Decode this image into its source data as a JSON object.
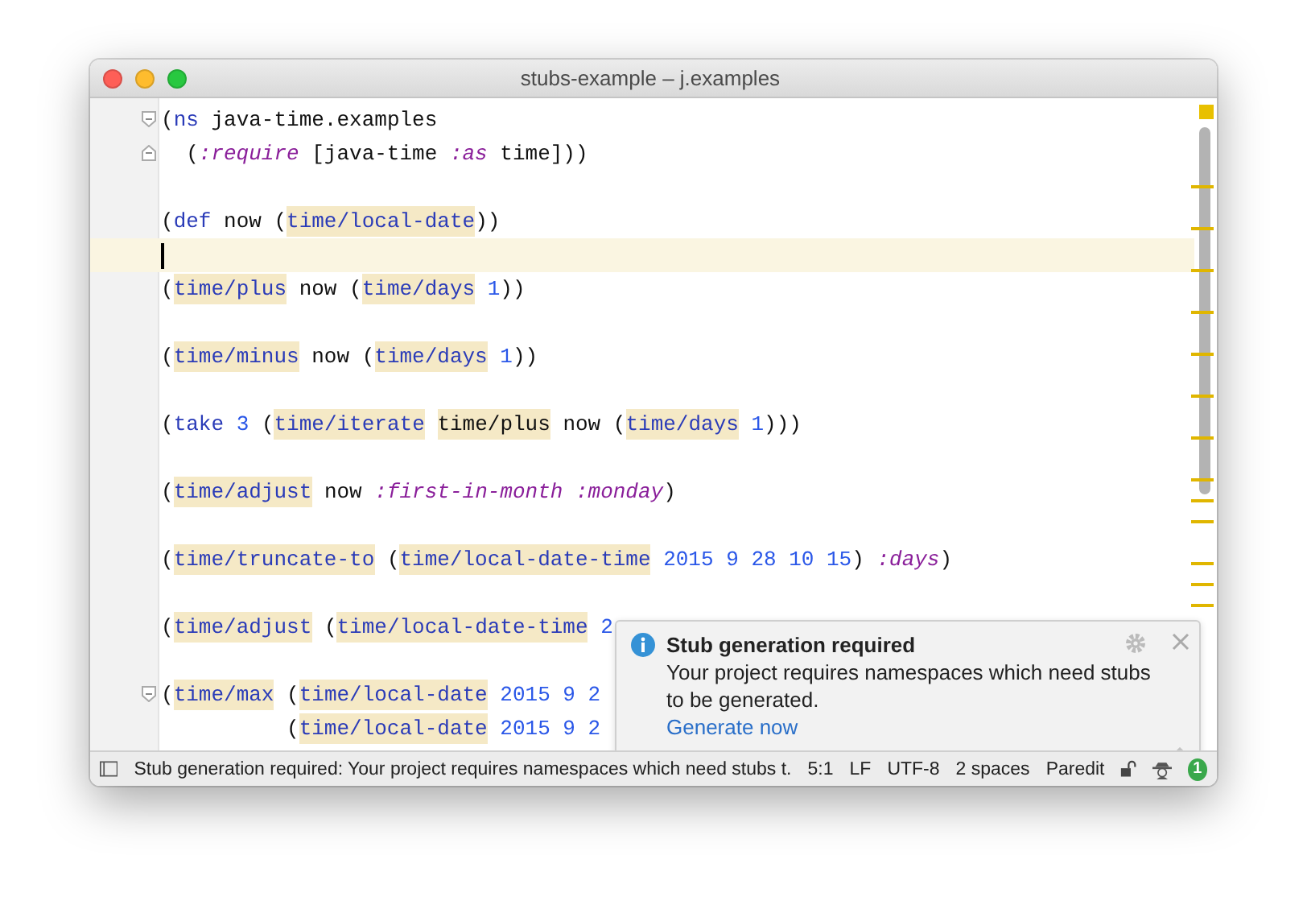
{
  "window": {
    "title": "stubs-example – j.examples"
  },
  "editor": {
    "lines": [
      {
        "kind": "code",
        "fold_start": true,
        "tokens": [
          {
            "kind": "plain",
            "text": "("
          },
          {
            "kind": "special",
            "text": "ns"
          },
          {
            "kind": "plain",
            "text": " java-time.examples"
          }
        ]
      },
      {
        "kind": "code",
        "fold_end": true,
        "tokens": [
          {
            "kind": "plain",
            "text": "  ("
          },
          {
            "kind": "keyword",
            "text": ":require"
          },
          {
            "kind": "plain",
            "text": " [java-time "
          },
          {
            "kind": "keyword",
            "text": ":as"
          },
          {
            "kind": "plain",
            "text": " time]))"
          }
        ]
      },
      {
        "kind": "blank"
      },
      {
        "kind": "code",
        "tokens": [
          {
            "kind": "plain",
            "text": "("
          },
          {
            "kind": "special",
            "text": "def"
          },
          {
            "kind": "plain",
            "text": " now ("
          },
          {
            "kind": "ref",
            "text": "time/local-date"
          },
          {
            "kind": "plain",
            "text": "))"
          }
        ]
      },
      {
        "kind": "cursor"
      },
      {
        "kind": "code",
        "tokens": [
          {
            "kind": "plain",
            "text": "("
          },
          {
            "kind": "ref",
            "text": "time/plus"
          },
          {
            "kind": "plain",
            "text": " now ("
          },
          {
            "kind": "ref",
            "text": "time/days"
          },
          {
            "kind": "number",
            "text": " 1"
          },
          {
            "kind": "plain",
            "text": "))"
          }
        ]
      },
      {
        "kind": "blank"
      },
      {
        "kind": "code",
        "tokens": [
          {
            "kind": "plain",
            "text": "("
          },
          {
            "kind": "ref",
            "text": "time/minus"
          },
          {
            "kind": "plain",
            "text": " now ("
          },
          {
            "kind": "ref",
            "text": "time/days"
          },
          {
            "kind": "number",
            "text": " 1"
          },
          {
            "kind": "plain",
            "text": "))"
          }
        ]
      },
      {
        "kind": "blank"
      },
      {
        "kind": "code",
        "tokens": [
          {
            "kind": "plain",
            "text": "("
          },
          {
            "kind": "special",
            "text": "take"
          },
          {
            "kind": "number",
            "text": " 3"
          },
          {
            "kind": "plain",
            "text": " ("
          },
          {
            "kind": "ref",
            "text": "time/iterate"
          },
          {
            "kind": "refplain",
            "text": " time/plus"
          },
          {
            "kind": "plain",
            "text": " now ("
          },
          {
            "kind": "ref",
            "text": "time/days"
          },
          {
            "kind": "number",
            "text": " 1"
          },
          {
            "kind": "plain",
            "text": ")))"
          }
        ]
      },
      {
        "kind": "blank"
      },
      {
        "kind": "code",
        "tokens": [
          {
            "kind": "plain",
            "text": "("
          },
          {
            "kind": "ref",
            "text": "time/adjust"
          },
          {
            "kind": "plain",
            "text": " now "
          },
          {
            "kind": "keyword",
            "text": ":first-in-month :monday"
          },
          {
            "kind": "plain",
            "text": ")"
          }
        ]
      },
      {
        "kind": "blank"
      },
      {
        "kind": "code",
        "tokens": [
          {
            "kind": "plain",
            "text": "("
          },
          {
            "kind": "ref",
            "text": "time/truncate-to"
          },
          {
            "kind": "plain",
            "text": " ("
          },
          {
            "kind": "ref",
            "text": "time/local-date-time"
          },
          {
            "kind": "number",
            "text": " 2015 9 28 10 15"
          },
          {
            "kind": "plain",
            "text": ") "
          },
          {
            "kind": "keyword",
            "text": ":days"
          },
          {
            "kind": "plain",
            "text": ")"
          }
        ]
      },
      {
        "kind": "blank"
      },
      {
        "kind": "code",
        "tokens": [
          {
            "kind": "plain",
            "text": "("
          },
          {
            "kind": "ref",
            "text": "time/adjust"
          },
          {
            "kind": "plain",
            "text": " ("
          },
          {
            "kind": "ref",
            "text": "time/local-date-time"
          },
          {
            "kind": "number",
            "text": " 2"
          }
        ]
      },
      {
        "kind": "blank"
      },
      {
        "kind": "code",
        "fold_start": true,
        "tokens": [
          {
            "kind": "plain",
            "text": "("
          },
          {
            "kind": "ref",
            "text": "time/max"
          },
          {
            "kind": "plain",
            "text": " ("
          },
          {
            "kind": "ref",
            "text": "time/local-date"
          },
          {
            "kind": "number",
            "text": " 2015 9 2"
          }
        ]
      },
      {
        "kind": "code",
        "tokens": [
          {
            "kind": "plain",
            "text": "          ("
          },
          {
            "kind": "ref",
            "text": "time/local-date"
          },
          {
            "kind": "number",
            "text": " 2015 9 2"
          }
        ]
      }
    ]
  },
  "notification": {
    "title": "Stub generation required",
    "message": "Your project requires namespaces which need stubs to be generated.",
    "action": "Generate now"
  },
  "status_bar": {
    "message": "Stub generation required: Your project requires namespaces which need stubs t.",
    "items": [
      "5:1",
      "LF",
      "UTF-8",
      "2 spaces",
      "Paredit"
    ],
    "badge": "1"
  }
}
